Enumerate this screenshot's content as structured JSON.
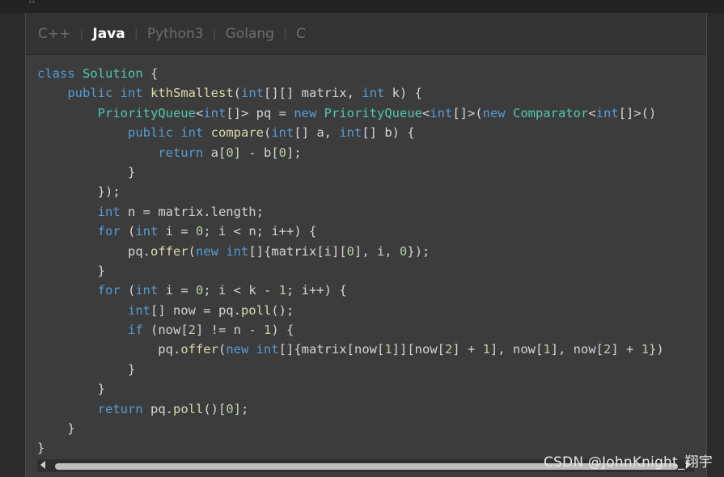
{
  "tabs": [
    "C++",
    "Java",
    "Python3",
    "Golang",
    "C"
  ],
  "active_tab": "Java",
  "code_lines": [
    [
      [
        "k",
        "class"
      ],
      [
        "p",
        " "
      ],
      [
        "t",
        "Solution"
      ],
      [
        "p",
        " {"
      ]
    ],
    [
      [
        "p",
        "    "
      ],
      [
        "k",
        "public"
      ],
      [
        "p",
        " "
      ],
      [
        "k",
        "int"
      ],
      [
        "p",
        " "
      ],
      [
        "f",
        "kthSmallest"
      ],
      [
        "p",
        "("
      ],
      [
        "k",
        "int"
      ],
      [
        "p",
        "[][] matrix, "
      ],
      [
        "k",
        "int"
      ],
      [
        "p",
        " k) {"
      ]
    ],
    [
      [
        "p",
        "        "
      ],
      [
        "t",
        "PriorityQueue"
      ],
      [
        "p",
        "<"
      ],
      [
        "k",
        "int"
      ],
      [
        "p",
        "[]> pq = "
      ],
      [
        "k",
        "new"
      ],
      [
        "p",
        " "
      ],
      [
        "t",
        "PriorityQueue"
      ],
      [
        "p",
        "<"
      ],
      [
        "k",
        "int"
      ],
      [
        "p",
        "[]>("
      ],
      [
        "k",
        "new"
      ],
      [
        "p",
        " "
      ],
      [
        "t",
        "Comparator"
      ],
      [
        "p",
        "<"
      ],
      [
        "k",
        "int"
      ],
      [
        "p",
        "[]>()"
      ]
    ],
    [
      [
        "p",
        "            "
      ],
      [
        "k",
        "public"
      ],
      [
        "p",
        " "
      ],
      [
        "k",
        "int"
      ],
      [
        "p",
        " "
      ],
      [
        "f",
        "compare"
      ],
      [
        "p",
        "("
      ],
      [
        "k",
        "int"
      ],
      [
        "p",
        "[] a, "
      ],
      [
        "k",
        "int"
      ],
      [
        "p",
        "[] b) {"
      ]
    ],
    [
      [
        "p",
        "                "
      ],
      [
        "k",
        "return"
      ],
      [
        "p",
        " a["
      ],
      [
        "n",
        "0"
      ],
      [
        "p",
        "] - b["
      ],
      [
        "n",
        "0"
      ],
      [
        "p",
        "];"
      ]
    ],
    [
      [
        "p",
        "            }"
      ]
    ],
    [
      [
        "p",
        "        });"
      ]
    ],
    [
      [
        "p",
        "        "
      ],
      [
        "k",
        "int"
      ],
      [
        "p",
        " n = matrix.length;"
      ]
    ],
    [
      [
        "p",
        "        "
      ],
      [
        "k",
        "for"
      ],
      [
        "p",
        " ("
      ],
      [
        "k",
        "int"
      ],
      [
        "p",
        " i = "
      ],
      [
        "n",
        "0"
      ],
      [
        "p",
        "; i < n; i++) {"
      ]
    ],
    [
      [
        "p",
        "            pq."
      ],
      [
        "f",
        "offer"
      ],
      [
        "p",
        "("
      ],
      [
        "k",
        "new"
      ],
      [
        "p",
        " "
      ],
      [
        "k",
        "int"
      ],
      [
        "p",
        "[]{matrix[i]["
      ],
      [
        "n",
        "0"
      ],
      [
        "p",
        "], i, "
      ],
      [
        "n",
        "0"
      ],
      [
        "p",
        "});"
      ]
    ],
    [
      [
        "p",
        "        }"
      ]
    ],
    [
      [
        "p",
        "        "
      ],
      [
        "k",
        "for"
      ],
      [
        "p",
        " ("
      ],
      [
        "k",
        "int"
      ],
      [
        "p",
        " i = "
      ],
      [
        "n",
        "0"
      ],
      [
        "p",
        "; i < k - "
      ],
      [
        "n",
        "1"
      ],
      [
        "p",
        "; i++) {"
      ]
    ],
    [
      [
        "p",
        "            "
      ],
      [
        "k",
        "int"
      ],
      [
        "p",
        "[] now = pq."
      ],
      [
        "f",
        "poll"
      ],
      [
        "p",
        "();"
      ]
    ],
    [
      [
        "p",
        "            "
      ],
      [
        "k",
        "if"
      ],
      [
        "p",
        " (now["
      ],
      [
        "n",
        "2"
      ],
      [
        "p",
        "] != n - "
      ],
      [
        "n",
        "1"
      ],
      [
        "p",
        ") {"
      ]
    ],
    [
      [
        "p",
        "                pq."
      ],
      [
        "f",
        "offer"
      ],
      [
        "p",
        "("
      ],
      [
        "k",
        "new"
      ],
      [
        "p",
        " "
      ],
      [
        "k",
        "int"
      ],
      [
        "p",
        "[]{matrix[now["
      ],
      [
        "n",
        "1"
      ],
      [
        "p",
        "]][now["
      ],
      [
        "n",
        "2"
      ],
      [
        "p",
        "] + "
      ],
      [
        "n",
        "1"
      ],
      [
        "p",
        "], now["
      ],
      [
        "n",
        "1"
      ],
      [
        "p",
        "], now["
      ],
      [
        "n",
        "2"
      ],
      [
        "p",
        "] + "
      ],
      [
        "n",
        "1"
      ],
      [
        "p",
        "})"
      ]
    ],
    [
      [
        "p",
        "            }"
      ]
    ],
    [
      [
        "p",
        "        }"
      ]
    ],
    [
      [
        "p",
        "        "
      ],
      [
        "k",
        "return"
      ],
      [
        "p",
        " pq."
      ],
      [
        "f",
        "poll"
      ],
      [
        "p",
        "()["
      ],
      [
        "n",
        "0"
      ],
      [
        "p",
        "];"
      ]
    ],
    [
      [
        "p",
        "    }"
      ]
    ],
    [
      [
        "p",
        "}"
      ]
    ]
  ],
  "watermark": "CSDN @JohnKnight_翔宇",
  "colors": {
    "keyword": "#569cd6",
    "type": "#4ec9b0",
    "function": "#dcdcaa",
    "number": "#b5cea8",
    "plain": "#d4d4d4",
    "background": "#3c3c3c"
  }
}
